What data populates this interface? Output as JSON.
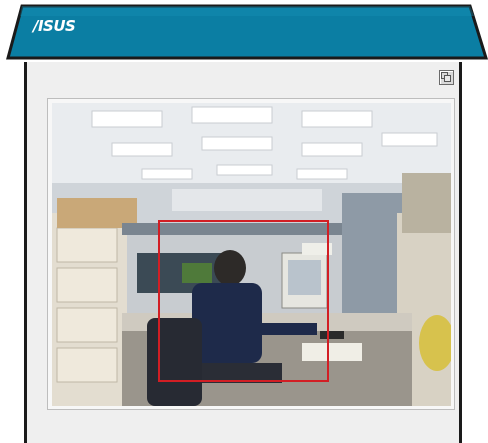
{
  "header": {
    "logo_text": "/ISUS",
    "background_color": "#0b7ea3"
  },
  "viewer": {
    "toggle_icon": "window-toggle-icon",
    "motion_region_color": "#d21e24"
  }
}
